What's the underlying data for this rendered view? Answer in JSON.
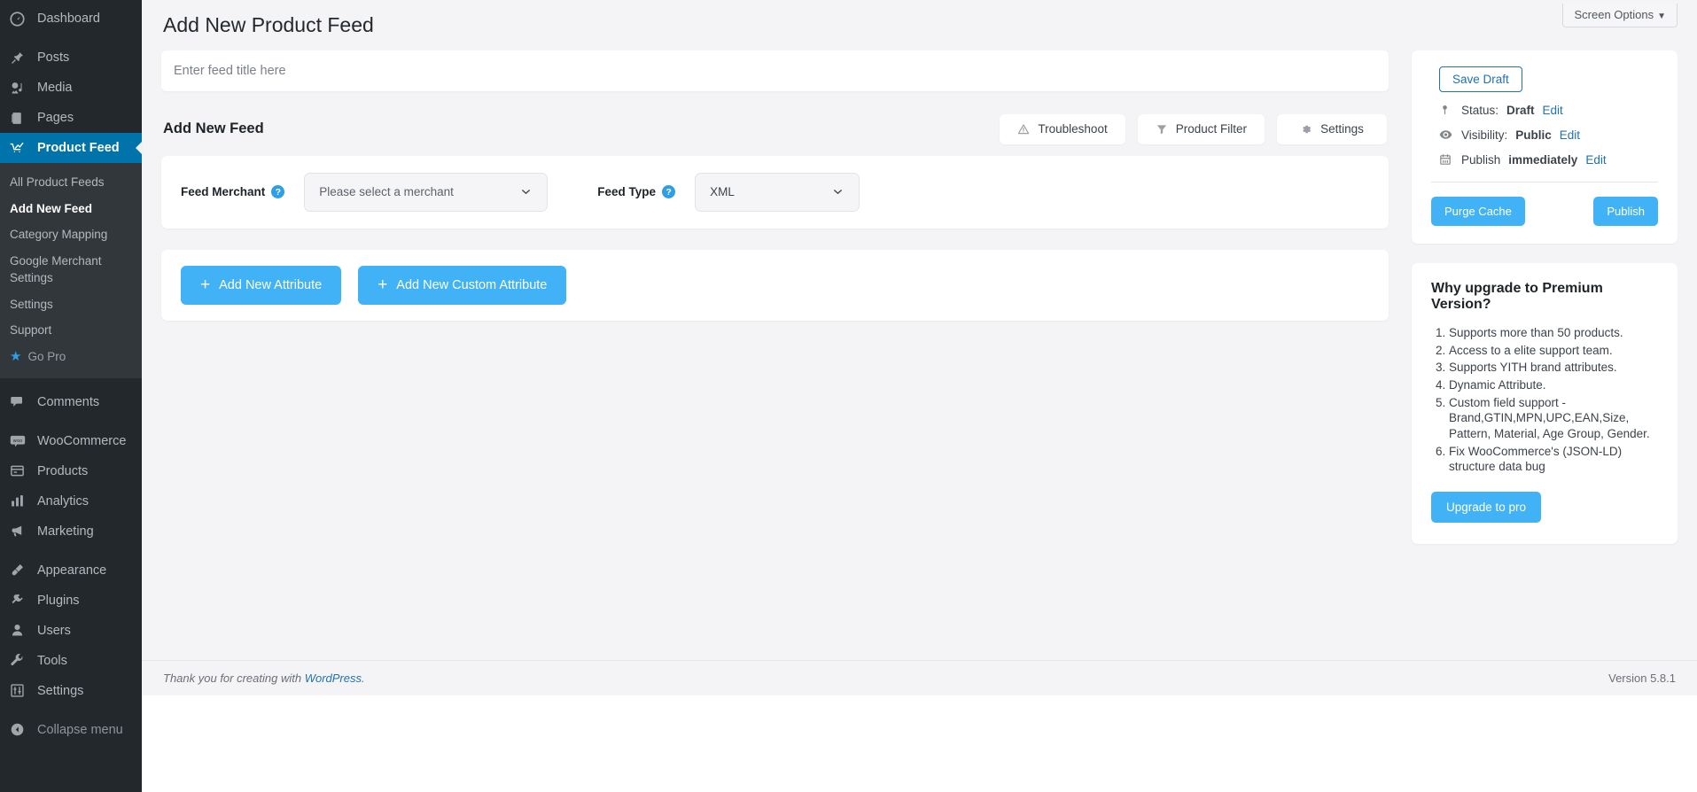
{
  "sidebar": {
    "items": [
      {
        "label": "Dashboard",
        "icon": "dashboard-icon"
      },
      {
        "label": "Posts",
        "icon": "pin-icon"
      },
      {
        "label": "Media",
        "icon": "media-icon"
      },
      {
        "label": "Pages",
        "icon": "page-icon"
      },
      {
        "label": "Product Feed",
        "icon": "chart-cart-icon"
      },
      {
        "label": "Comments",
        "icon": "comment-icon"
      },
      {
        "label": "WooCommerce",
        "icon": "woo-icon"
      },
      {
        "label": "Products",
        "icon": "products-icon"
      },
      {
        "label": "Analytics",
        "icon": "analytics-icon"
      },
      {
        "label": "Marketing",
        "icon": "megaphone-icon"
      },
      {
        "label": "Appearance",
        "icon": "brush-icon"
      },
      {
        "label": "Plugins",
        "icon": "plug-icon"
      },
      {
        "label": "Users",
        "icon": "user-icon"
      },
      {
        "label": "Tools",
        "icon": "wrench-icon"
      },
      {
        "label": "Settings",
        "icon": "sliders-icon"
      },
      {
        "label": "Collapse menu",
        "icon": "collapse-icon"
      }
    ],
    "submenu": [
      {
        "label": "All Product Feeds"
      },
      {
        "label": "Add New Feed"
      },
      {
        "label": "Category Mapping"
      },
      {
        "label": "Google Merchant Settings"
      },
      {
        "label": "Settings"
      },
      {
        "label": "Support"
      },
      {
        "label": "Go Pro"
      }
    ],
    "active_item": "Product Feed",
    "current_subitem": "Add New Feed",
    "accent": "#0073aa"
  },
  "header": {
    "screen_options": "Screen Options",
    "screen_options_caret": "▼",
    "page_title": "Add New Product Feed"
  },
  "title_field": {
    "placeholder": "Enter feed title here",
    "value": ""
  },
  "feed_section": {
    "heading": "Add New Feed",
    "buttons": [
      {
        "label": "Troubleshoot",
        "icon": "warning-triangle-icon"
      },
      {
        "label": "Product Filter",
        "icon": "funnel-icon"
      },
      {
        "label": "Settings",
        "icon": "gear-icon"
      }
    ],
    "fields": [
      {
        "label": "Feed Merchant",
        "help": "?",
        "value": "Please select a merchant"
      },
      {
        "label": "Feed Type",
        "help": "?",
        "value": "XML"
      }
    ]
  },
  "attribute_section": {
    "buttons": [
      {
        "label": "Add New Attribute",
        "icon": "plus-icon",
        "plus": "+"
      },
      {
        "label": "Add New Custom Attribute",
        "icon": "plus-icon",
        "plus": "+"
      }
    ]
  },
  "publish_box": {
    "save_draft": "Save Draft",
    "status_label": "Status:",
    "status_value": "Draft",
    "status_edit": "Edit",
    "visibility_label": "Visibility:",
    "visibility_value": "Public",
    "visibility_edit": "Edit",
    "publish_label": "Publish",
    "publish_value": "immediately",
    "publish_edit": "Edit",
    "purge_cache": "Purge Cache",
    "publish_button": "Publish",
    "accent": "#41b2f5"
  },
  "promo_box": {
    "heading": "Why upgrade to Premium Version?",
    "items": [
      "Supports more than 50 products.",
      "Access to a elite support team.",
      "Supports YITH brand attributes.",
      "Dynamic Attribute.",
      "Custom field support - Brand,GTIN,MPN,UPC,EAN,Size, Pattern, Material, Age Group, Gender.",
      "Fix WooCommerce's (JSON-LD) structure data bug"
    ],
    "button": "Upgrade to pro"
  },
  "footer": {
    "thanks_prefix": "Thank you for creating with",
    "link": "WordPress",
    "suffix": ".",
    "version": "Version 5.8.1"
  }
}
